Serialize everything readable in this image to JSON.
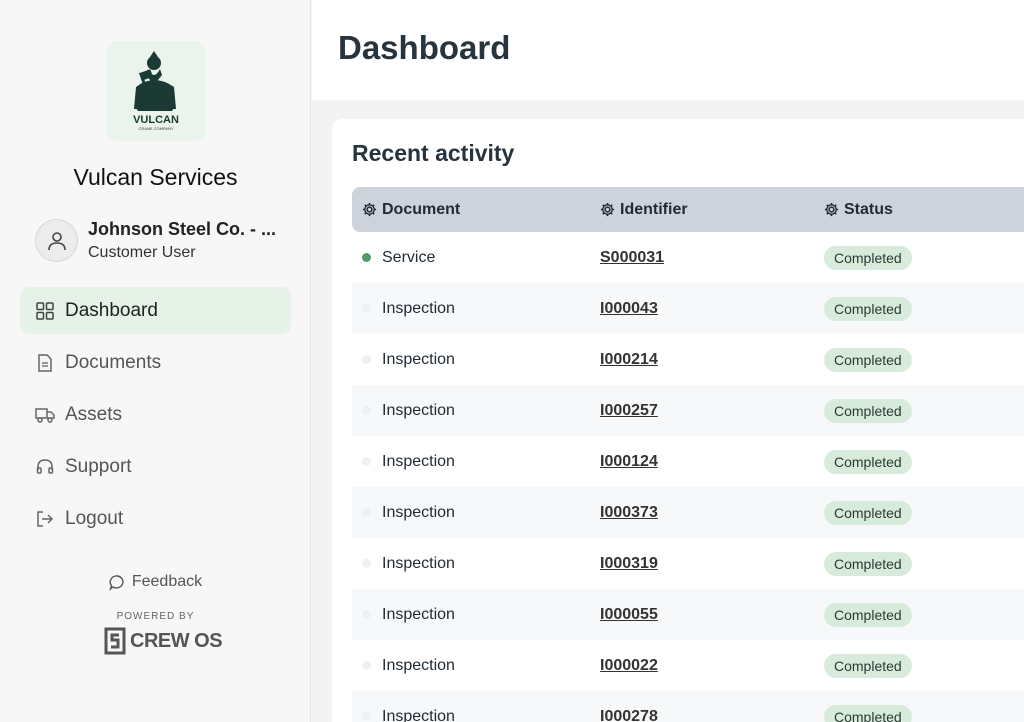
{
  "sidebar": {
    "brand_name": "Vulcan Services",
    "logo_text": "VULCAN",
    "logo_subtext": "CRANE COMPANY",
    "user": {
      "name": "Johnson Steel Co. - ...",
      "role": "Customer User"
    },
    "nav": [
      {
        "label": "Dashboard",
        "icon": "grid-icon",
        "active": true
      },
      {
        "label": "Documents",
        "icon": "document-icon",
        "active": false
      },
      {
        "label": "Assets",
        "icon": "truck-icon",
        "active": false
      },
      {
        "label": "Support",
        "icon": "headset-icon",
        "active": false
      },
      {
        "label": "Logout",
        "icon": "logout-icon",
        "active": false
      }
    ],
    "feedback_label": "Feedback",
    "powered_by": "POWERED BY",
    "powered_brand": "CREW OS"
  },
  "header": {
    "title": "Dashboard"
  },
  "recent_activity": {
    "title": "Recent activity",
    "columns": [
      "Document",
      "Identifier",
      "Status"
    ],
    "rows": [
      {
        "document": "Service",
        "identifier": "S000031",
        "status": "Completed"
      },
      {
        "document": "Inspection",
        "identifier": "I000043",
        "status": "Completed"
      },
      {
        "document": "Inspection",
        "identifier": "I000214",
        "status": "Completed"
      },
      {
        "document": "Inspection",
        "identifier": "I000257",
        "status": "Completed"
      },
      {
        "document": "Inspection",
        "identifier": "I000124",
        "status": "Completed"
      },
      {
        "document": "Inspection",
        "identifier": "I000373",
        "status": "Completed"
      },
      {
        "document": "Inspection",
        "identifier": "I000319",
        "status": "Completed"
      },
      {
        "document": "Inspection",
        "identifier": "I000055",
        "status": "Completed"
      },
      {
        "document": "Inspection",
        "identifier": "I000022",
        "status": "Completed"
      },
      {
        "document": "Inspection",
        "identifier": "I000278",
        "status": "Completed"
      }
    ]
  },
  "colors": {
    "accent_bg": "#e6f2e7",
    "status_badge": "#d7ebdc",
    "active_dot": "#4f9b6b",
    "table_header": "#ced3db"
  }
}
